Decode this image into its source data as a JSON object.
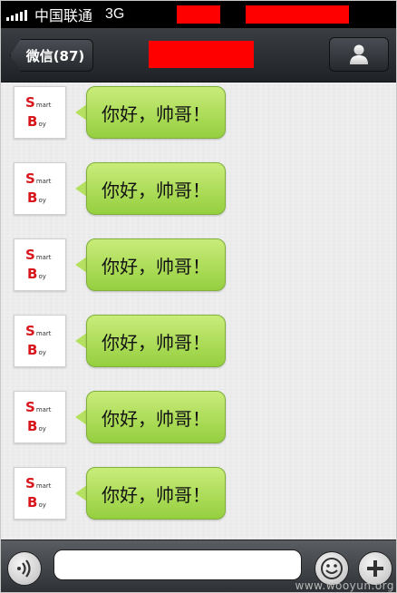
{
  "status_bar": {
    "carrier": "中国联通",
    "network": "3G",
    "signal_bars": 5
  },
  "nav": {
    "back_label": "微信(87)",
    "profile_icon": "person-icon"
  },
  "messages": [
    {
      "avatar_line1": "S",
      "avatar_line1_small": "mart",
      "avatar_line2": "B",
      "avatar_line2_small": "oy",
      "text": "你好，帅哥！"
    },
    {
      "avatar_line1": "S",
      "avatar_line1_small": "mart",
      "avatar_line2": "B",
      "avatar_line2_small": "oy",
      "text": "你好，帅哥！"
    },
    {
      "avatar_line1": "S",
      "avatar_line1_small": "mart",
      "avatar_line2": "B",
      "avatar_line2_small": "oy",
      "text": "你好，帅哥！"
    },
    {
      "avatar_line1": "S",
      "avatar_line1_small": "mart",
      "avatar_line2": "B",
      "avatar_line2_small": "oy",
      "text": "你好，帅哥！"
    },
    {
      "avatar_line1": "S",
      "avatar_line1_small": "mart",
      "avatar_line2": "B",
      "avatar_line2_small": "oy",
      "text": "你好，帅哥！"
    },
    {
      "avatar_line1": "S",
      "avatar_line1_small": "mart",
      "avatar_line2": "B",
      "avatar_line2_small": "oy",
      "text": "你好，帅哥！"
    }
  ],
  "input_bar": {
    "text_value": "",
    "voice_icon": "voice-icon",
    "emoji_icon": "emoji-icon",
    "plus_icon": "plus-icon"
  },
  "watermark": "www.wooyun.org",
  "colors": {
    "bubble_green": "#b6e160",
    "redaction": "#ff0000",
    "avatar_red": "#d8161c"
  }
}
